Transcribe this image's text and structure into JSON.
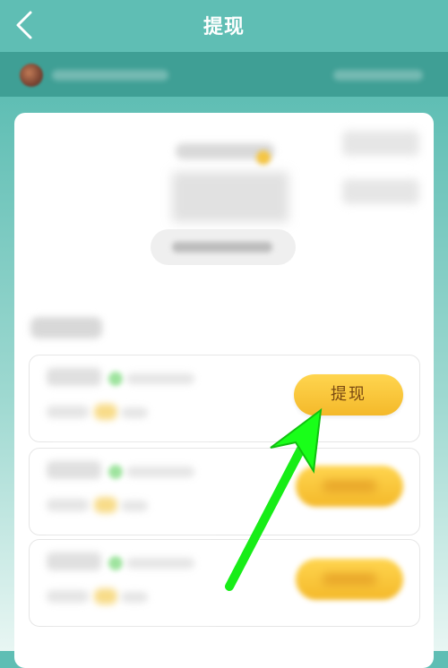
{
  "header": {
    "title": "提现"
  },
  "withdraw_button_label": "提现",
  "colors": {
    "header_bg": "#5fbeb4",
    "userbar_bg": "#3f9f95",
    "accent_yellow": "#f4b92a",
    "arrow_green": "#19ff19"
  }
}
